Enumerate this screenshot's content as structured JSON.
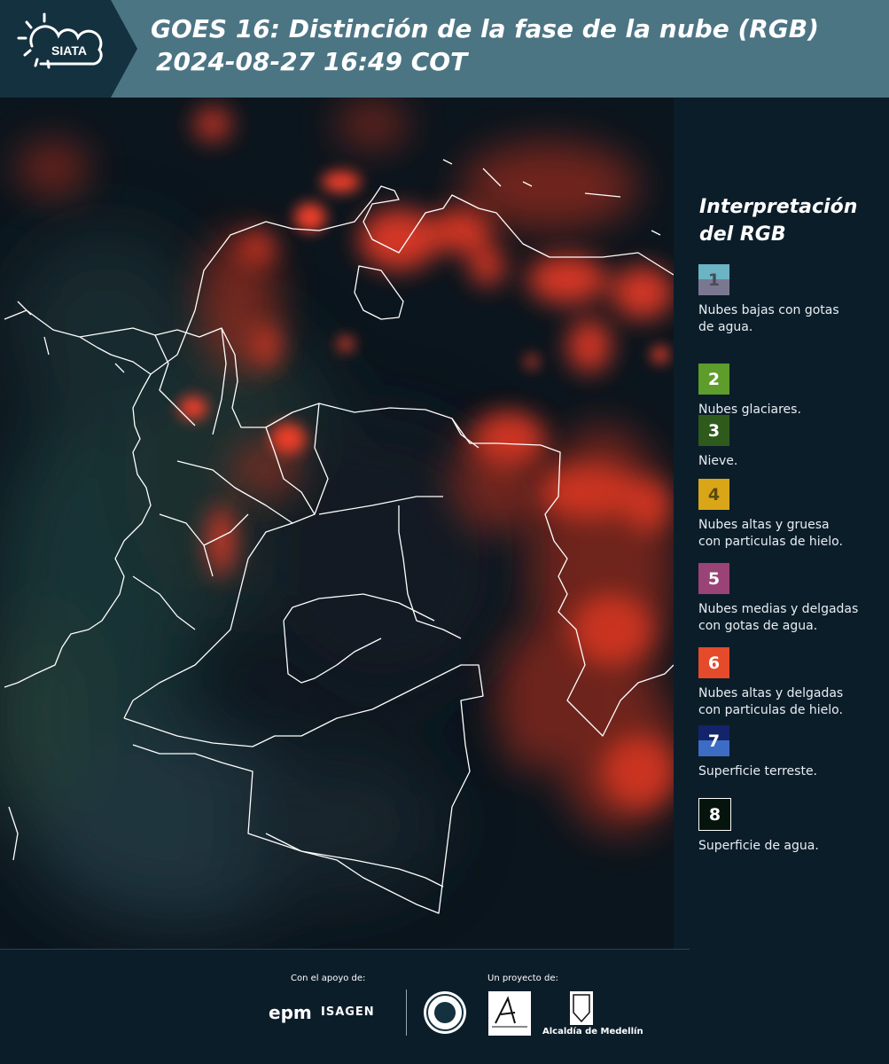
{
  "header": {
    "logo_text": "SIATA",
    "title_line1": "GOES 16: Distinción de la fase de la nube (RGB)",
    "title_line2": "2024-08-27 16:49 COT"
  },
  "legend": {
    "title_line1": "Interpretación",
    "title_line2": "del RGB",
    "items": [
      {
        "number": "1",
        "colors": [
          "#6ab4c4",
          "#7a7891"
        ],
        "text_color": "#4a4a5a",
        "description_lines": [
          "Nubes bajas con gotas",
          "de agua."
        ]
      },
      {
        "number": "2",
        "colors": [
          "#5e9c2c"
        ],
        "text_color": "#ffffff",
        "description_lines": [
          "Nubes glaciares."
        ]
      },
      {
        "number": "3",
        "colors": [
          "#2e5a1c"
        ],
        "text_color": "#ffffff",
        "description_lines": [
          "Nieve."
        ]
      },
      {
        "number": "4",
        "colors": [
          "#d9a618"
        ],
        "text_color": "#5a4a10",
        "description_lines": [
          "Nubes altas y gruesa",
          "con particulas de hielo."
        ]
      },
      {
        "number": "5",
        "colors": [
          "#9a4377"
        ],
        "text_color": "#ffffff",
        "description_lines": [
          "Nubes medias y delgadas",
          "con gotas de agua."
        ]
      },
      {
        "number": "6",
        "colors": [
          "#e54a2b"
        ],
        "text_color": "#ffffff",
        "description_lines": [
          "Nubes altas y delgadas",
          "con particulas de hielo."
        ]
      },
      {
        "number": "7",
        "colors": [
          "#14246a",
          "#3d6cc4"
        ],
        "text_color": "#ffffff",
        "description_lines": [
          "Superficie terreste."
        ]
      },
      {
        "number": "8",
        "colors": [
          "#05140c"
        ],
        "text_color": "#ffffff",
        "description_lines": [
          "Superficie de agua."
        ]
      }
    ]
  },
  "footer": {
    "support_label": "Con el apoyo de:",
    "project_label": "Un proyecto de:",
    "sponsor1": "epm",
    "sponsor2": "ISAGEN",
    "partner_area": "Área Metropolitana",
    "partner_alcaldia": "Alcaldía de Medellín"
  },
  "colors": {
    "header_bg": "#4c7584",
    "panel_bg": "#0c1d2a",
    "cloud_ice": "#f2412b",
    "border_line": "#ffffff"
  }
}
